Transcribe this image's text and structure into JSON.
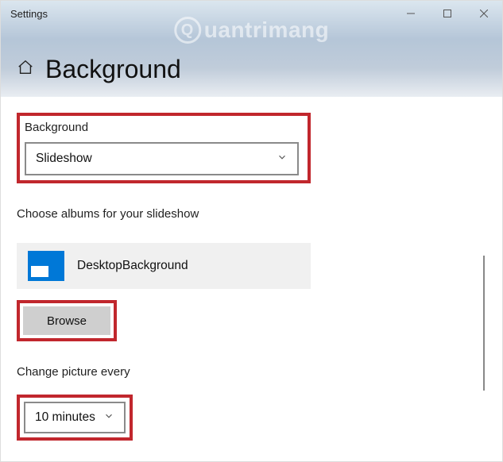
{
  "window": {
    "title": "Settings"
  },
  "watermark": "uantrimang",
  "header": {
    "page_title": "Background"
  },
  "sections": {
    "background_label": "Background",
    "background_value": "Slideshow",
    "albums_label": "Choose albums for your slideshow",
    "album_name": "DesktopBackground",
    "browse_label": "Browse",
    "change_label": "Change picture every",
    "change_value": "10 minutes"
  }
}
